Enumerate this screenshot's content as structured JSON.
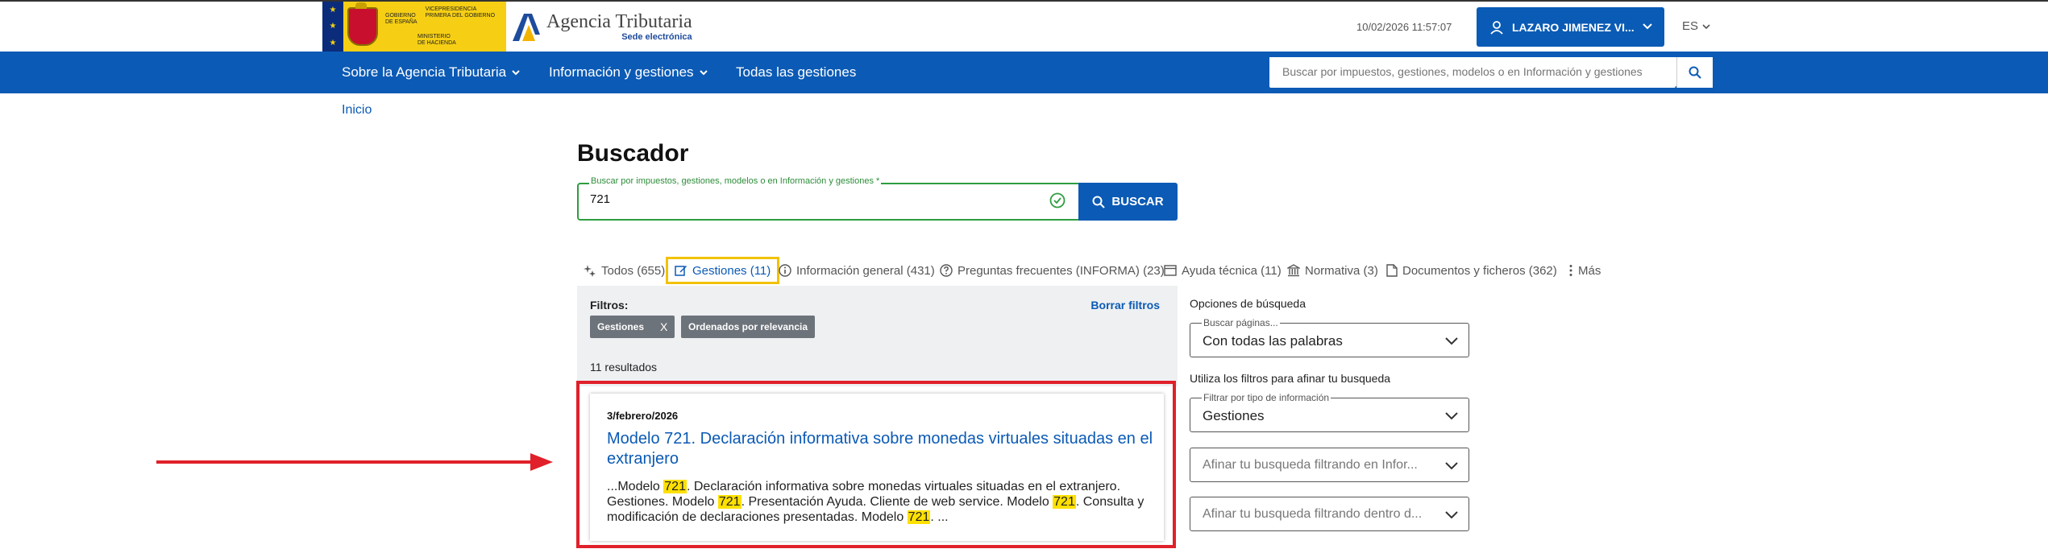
{
  "header": {
    "gov_logo_text": {
      "line1": "GOBIERNO",
      "line2": "DE ESPAÑA",
      "vice1": "VICEPRESIDENCIA",
      "vice2": "PRIMERA DEL GOBIERNO",
      "min1": "MINISTERIO",
      "min2": "DE HACIENDA"
    },
    "agency_title": "Agencia Tributaria",
    "agency_subtitle": "Sede electrónica",
    "datetime": "10/02/2026 11:57:07",
    "user_name": "LAZARO JIMENEZ VI...",
    "language": "ES"
  },
  "navbar": {
    "items": [
      {
        "label": "Sobre la Agencia Tributaria",
        "has_dropdown": true
      },
      {
        "label": "Información y gestiones",
        "has_dropdown": true
      },
      {
        "label": "Todas las gestiones",
        "has_dropdown": false
      }
    ],
    "search_placeholder": "Buscar por impuestos, gestiones, modelos o en Información y gestiones"
  },
  "breadcrumb": "Inicio",
  "main": {
    "title": "Buscador",
    "search_label": "Buscar por impuestos, gestiones, modelos o en Información y gestiones *",
    "search_value": "721",
    "search_button": "BUSCAR"
  },
  "tabs": [
    {
      "label": "Todos (655)",
      "icon": "sparkle-icon",
      "active": false
    },
    {
      "label": "Gestiones (11)",
      "icon": "edit-icon",
      "active": true
    },
    {
      "label": "Información general (431)",
      "icon": "info-icon",
      "active": false
    },
    {
      "label": "Preguntas frecuentes (INFORMA) (23)",
      "icon": "question-icon",
      "active": false
    },
    {
      "label": "Ayuda técnica (11)",
      "icon": "window-icon",
      "active": false
    },
    {
      "label": "Normativa (3)",
      "icon": "building-icon",
      "active": false
    },
    {
      "label": "Documentos y ficheros (362)",
      "icon": "document-icon",
      "active": false
    },
    {
      "label": "Más",
      "icon": "more-vertical-icon",
      "active": false
    }
  ],
  "filters": {
    "title": "Filtros:",
    "clear": "Borrar filtros",
    "chips": [
      {
        "label": "Gestiones",
        "remove": "X"
      },
      {
        "label": "Ordenados por relevancia"
      }
    ],
    "results_count": "11 resultados"
  },
  "result": {
    "date": "3/febrero/2026",
    "title": "Modelo 721. Declaración informativa sobre monedas virtuales situadas en el extranjero",
    "snippet_parts": [
      "...Modelo ",
      "721",
      ". Declaración informativa sobre monedas virtuales situadas en el extranjero. Gestiones. Modelo ",
      "721",
      ". Presentación Ayuda. Cliente de web service. Modelo ",
      "721",
      ". Consulta y modificación de declaraciones presentadas. Modelo ",
      "721",
      ". ..."
    ]
  },
  "options": {
    "title": "Opciones de búsqueda",
    "search_pages_label": "Buscar páginas...",
    "search_pages_value": "Con todas las palabras",
    "refine_title": "Utiliza los filtros para afinar tu busqueda",
    "type_label": "Filtrar por tipo de información",
    "type_value": "Gestiones",
    "refine_info_placeholder": "Afinar tu busqueda filtrando en Infor...",
    "refine_inside_placeholder": "Afinar tu busqueda filtrando dentro d..."
  },
  "colors": {
    "brand_blue": "#0b5ab5",
    "highlight_red": "#e0202a",
    "active_tab_border": "#f2c200",
    "success_green": "#2e9d40"
  }
}
